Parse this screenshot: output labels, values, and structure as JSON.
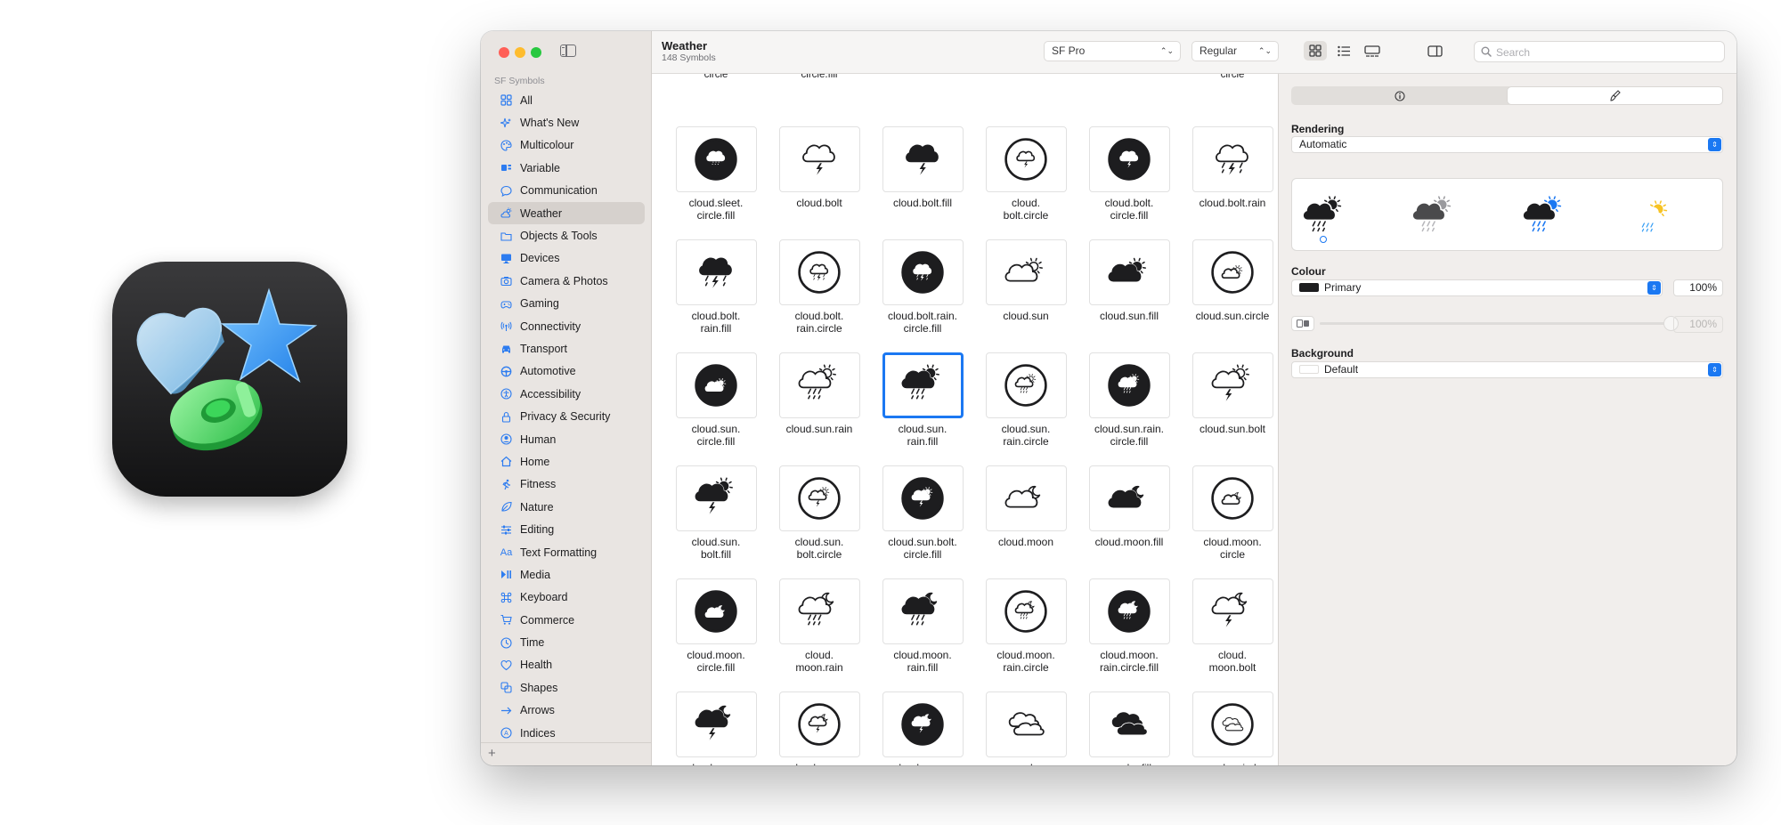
{
  "sidebar": {
    "section_label": "SF Symbols",
    "items": [
      {
        "label": "All",
        "icon": "grid-icon",
        "glyph": "grid",
        "active": false
      },
      {
        "label": "What's New",
        "icon": "sparkles-icon",
        "glyph": "sparkles",
        "active": false
      },
      {
        "label": "Multicolour",
        "icon": "paintpalette-icon",
        "glyph": "palette",
        "active": false
      },
      {
        "label": "Variable",
        "icon": "slider-icon",
        "glyph": "variable",
        "active": false
      },
      {
        "label": "Communication",
        "icon": "message-icon",
        "glyph": "bubble",
        "active": false
      },
      {
        "label": "Weather",
        "icon": "cloud-sun-icon",
        "glyph": "cloudsun",
        "active": true
      },
      {
        "label": "Objects & Tools",
        "icon": "folder-icon",
        "glyph": "folder",
        "active": false
      },
      {
        "label": "Devices",
        "icon": "desktop-icon",
        "glyph": "desktop",
        "active": false
      },
      {
        "label": "Camera & Photos",
        "icon": "camera-icon",
        "glyph": "camera",
        "active": false
      },
      {
        "label": "Gaming",
        "icon": "gamecontroller-icon",
        "glyph": "gamepad",
        "active": false
      },
      {
        "label": "Connectivity",
        "icon": "antenna-icon",
        "glyph": "antenna",
        "active": false
      },
      {
        "label": "Transport",
        "icon": "car-icon",
        "glyph": "car",
        "active": false
      },
      {
        "label": "Automotive",
        "icon": "steering-wheel-icon",
        "glyph": "wheel",
        "active": false
      },
      {
        "label": "Accessibility",
        "icon": "accessibility-icon",
        "glyph": "access",
        "active": false
      },
      {
        "label": "Privacy & Security",
        "icon": "lock-icon",
        "glyph": "lock",
        "active": false
      },
      {
        "label": "Human",
        "icon": "person-icon",
        "glyph": "person",
        "active": false
      },
      {
        "label": "Home",
        "icon": "house-icon",
        "glyph": "house",
        "active": false
      },
      {
        "label": "Fitness",
        "icon": "figure-run-icon",
        "glyph": "run",
        "active": false
      },
      {
        "label": "Nature",
        "icon": "leaf-icon",
        "glyph": "leaf",
        "active": false
      },
      {
        "label": "Editing",
        "icon": "sliders-icon",
        "glyph": "sliders",
        "active": false
      },
      {
        "label": "Text Formatting",
        "icon": "textformat-icon",
        "glyph": "Aa",
        "active": false
      },
      {
        "label": "Media",
        "icon": "playpause-icon",
        "glyph": "media",
        "active": false
      },
      {
        "label": "Keyboard",
        "icon": "command-icon",
        "glyph": "command",
        "active": false
      },
      {
        "label": "Commerce",
        "icon": "cart-icon",
        "glyph": "cart",
        "active": false
      },
      {
        "label": "Time",
        "icon": "clock-icon",
        "glyph": "clock",
        "active": false
      },
      {
        "label": "Health",
        "icon": "heart-icon",
        "glyph": "heart",
        "active": false
      },
      {
        "label": "Shapes",
        "icon": "shapes-icon",
        "glyph": "shapes",
        "active": false
      },
      {
        "label": "Arrows",
        "icon": "arrow-right-icon",
        "glyph": "arrow",
        "active": false
      },
      {
        "label": "Indices",
        "icon": "indices-icon",
        "glyph": "indices",
        "active": false
      }
    ]
  },
  "toolbar": {
    "title": "Weather",
    "subtitle": "148 Symbols",
    "font_popup": "SF Pro",
    "weight_popup": "Regular",
    "search_placeholder": "Search"
  },
  "grid": {
    "partial_labels": [
      "circle",
      "circle.fill",
      "",
      "",
      "",
      "circle"
    ],
    "symbols": [
      {
        "label": "cloud.sleet.\ncircle.fill",
        "icon": "cloud-sleet-circle-fill-icon",
        "shape": "cloud",
        "style": "circle-fill",
        "precip": "sleet",
        "extra": "none",
        "selected": false
      },
      {
        "label": "cloud.bolt",
        "icon": "cloud-bolt-icon",
        "shape": "cloud",
        "style": "outline",
        "precip": "bolt",
        "extra": "none",
        "selected": false
      },
      {
        "label": "cloud.bolt.fill",
        "icon": "cloud-bolt-fill-icon",
        "shape": "cloud",
        "style": "fill",
        "precip": "bolt",
        "extra": "none",
        "selected": false
      },
      {
        "label": "cloud.\nbolt.circle",
        "icon": "cloud-bolt-circle-icon",
        "shape": "cloud",
        "style": "circle",
        "precip": "bolt",
        "extra": "none",
        "selected": false
      },
      {
        "label": "cloud.bolt.\ncircle.fill",
        "icon": "cloud-bolt-circle-fill-icon",
        "shape": "cloud",
        "style": "circle-fill",
        "precip": "bolt",
        "extra": "none",
        "selected": false
      },
      {
        "label": "cloud.bolt.rain",
        "icon": "cloud-bolt-rain-icon",
        "shape": "cloud",
        "style": "outline",
        "precip": "boltrain",
        "extra": "none",
        "selected": false
      },
      {
        "label": "cloud.bolt.\nrain.fill",
        "icon": "cloud-bolt-rain-fill-icon",
        "shape": "cloud",
        "style": "fill",
        "precip": "boltrain",
        "extra": "none",
        "selected": false
      },
      {
        "label": "cloud.bolt.\nrain.circle",
        "icon": "cloud-bolt-rain-circle-icon",
        "shape": "cloud",
        "style": "circle",
        "precip": "boltrain",
        "extra": "none",
        "selected": false
      },
      {
        "label": "cloud.bolt.rain.\ncircle.fill",
        "icon": "cloud-bolt-rain-circle-fill-icon",
        "shape": "cloud",
        "style": "circle-fill",
        "precip": "boltrain",
        "extra": "none",
        "selected": false
      },
      {
        "label": "cloud.sun",
        "icon": "cloud-sun-icon",
        "shape": "cloud",
        "style": "outline",
        "precip": "none",
        "extra": "sun",
        "selected": false
      },
      {
        "label": "cloud.sun.fill",
        "icon": "cloud-sun-fill-icon",
        "shape": "cloud",
        "style": "fill",
        "precip": "none",
        "extra": "sun",
        "selected": false
      },
      {
        "label": "cloud.sun.circle",
        "icon": "cloud-sun-circle-icon",
        "shape": "cloud",
        "style": "circle",
        "precip": "none",
        "extra": "sun",
        "selected": false
      },
      {
        "label": "cloud.sun.\ncircle.fill",
        "icon": "cloud-sun-circle-fill-icon",
        "shape": "cloud",
        "style": "circle-fill",
        "precip": "none",
        "extra": "sun",
        "selected": false
      },
      {
        "label": "cloud.sun.rain",
        "icon": "cloud-sun-rain-icon",
        "shape": "cloud",
        "style": "outline",
        "precip": "rain",
        "extra": "sun",
        "selected": false
      },
      {
        "label": "cloud.sun.\nrain.fill",
        "icon": "cloud-sun-rain-fill-icon",
        "shape": "cloud",
        "style": "fill",
        "precip": "rain",
        "extra": "sun",
        "selected": true
      },
      {
        "label": "cloud.sun.\nrain.circle",
        "icon": "cloud-sun-rain-circle-icon",
        "shape": "cloud",
        "style": "circle",
        "precip": "rain",
        "extra": "sun",
        "selected": false
      },
      {
        "label": "cloud.sun.rain.\ncircle.fill",
        "icon": "cloud-sun-rain-circle-fill-icon",
        "shape": "cloud",
        "style": "circle-fill",
        "precip": "rain",
        "extra": "sun",
        "selected": false
      },
      {
        "label": "cloud.sun.bolt",
        "icon": "cloud-sun-bolt-icon",
        "shape": "cloud",
        "style": "outline",
        "precip": "bolt",
        "extra": "sun",
        "selected": false
      },
      {
        "label": "cloud.sun.\nbolt.fill",
        "icon": "cloud-sun-bolt-fill-icon",
        "shape": "cloud",
        "style": "fill",
        "precip": "bolt",
        "extra": "sun",
        "selected": false
      },
      {
        "label": "cloud.sun.\nbolt.circle",
        "icon": "cloud-sun-bolt-circle-icon",
        "shape": "cloud",
        "style": "circle",
        "precip": "bolt",
        "extra": "sun",
        "selected": false
      },
      {
        "label": "cloud.sun.bolt.\ncircle.fill",
        "icon": "cloud-sun-bolt-circle-fill-icon",
        "shape": "cloud",
        "style": "circle-fill",
        "precip": "bolt",
        "extra": "sun",
        "selected": false
      },
      {
        "label": "cloud.moon",
        "icon": "cloud-moon-icon",
        "shape": "cloud",
        "style": "outline",
        "precip": "none",
        "extra": "moon",
        "selected": false
      },
      {
        "label": "cloud.moon.fill",
        "icon": "cloud-moon-fill-icon",
        "shape": "cloud",
        "style": "fill",
        "precip": "none",
        "extra": "moon",
        "selected": false
      },
      {
        "label": "cloud.moon.\ncircle",
        "icon": "cloud-moon-circle-icon",
        "shape": "cloud",
        "style": "circle",
        "precip": "none",
        "extra": "moon",
        "selected": false
      },
      {
        "label": "cloud.moon.\ncircle.fill",
        "icon": "cloud-moon-circle-fill-icon",
        "shape": "cloud",
        "style": "circle-fill",
        "precip": "none",
        "extra": "moon",
        "selected": false
      },
      {
        "label": "cloud.\nmoon.rain",
        "icon": "cloud-moon-rain-icon",
        "shape": "cloud",
        "style": "outline",
        "precip": "rain",
        "extra": "moon",
        "selected": false
      },
      {
        "label": "cloud.moon.\nrain.fill",
        "icon": "cloud-moon-rain-fill-icon",
        "shape": "cloud",
        "style": "fill",
        "precip": "rain",
        "extra": "moon",
        "selected": false
      },
      {
        "label": "cloud.moon.\nrain.circle",
        "icon": "cloud-moon-rain-circle-icon",
        "shape": "cloud",
        "style": "circle",
        "precip": "rain",
        "extra": "moon",
        "selected": false
      },
      {
        "label": "cloud.moon.\nrain.circle.fill",
        "icon": "cloud-moon-rain-circle-fill-icon",
        "shape": "cloud",
        "style": "circle-fill",
        "precip": "rain",
        "extra": "moon",
        "selected": false
      },
      {
        "label": "cloud.\nmoon.bolt",
        "icon": "cloud-moon-bolt-icon",
        "shape": "cloud",
        "style": "outline",
        "precip": "bolt",
        "extra": "moon",
        "selected": false
      },
      {
        "label": "cloud.moon.\nbolt.fill",
        "icon": "cloud-moon-bolt-fill-icon",
        "shape": "cloud",
        "style": "fill",
        "precip": "bolt",
        "extra": "moon",
        "selected": false
      },
      {
        "label": "cloud.moon.\nbolt.circle",
        "icon": "cloud-moon-bolt-circle-icon",
        "shape": "cloud",
        "style": "circle",
        "precip": "bolt",
        "extra": "moon",
        "selected": false
      },
      {
        "label": "cloud.moon.\nbolt.circle.fill",
        "icon": "cloud-moon-bolt-circle-fill-icon",
        "shape": "cloud",
        "style": "circle-fill",
        "precip": "bolt",
        "extra": "moon",
        "selected": false
      },
      {
        "label": "smoke",
        "icon": "smoke-icon",
        "shape": "smoke",
        "style": "outline",
        "precip": "none",
        "extra": "none",
        "selected": false
      },
      {
        "label": "smoke.fill",
        "icon": "smoke-fill-icon",
        "shape": "smoke",
        "style": "fill",
        "precip": "none",
        "extra": "none",
        "selected": false
      },
      {
        "label": "smoke.circle",
        "icon": "smoke-circle-icon",
        "shape": "smoke",
        "style": "circle",
        "precip": "none",
        "extra": "none",
        "selected": false
      }
    ]
  },
  "inspector": {
    "tabs": [
      {
        "icon": "info-icon",
        "active": false
      },
      {
        "icon": "paintbrush-icon",
        "active": true
      }
    ],
    "rendering_heading": "Rendering",
    "rendering_value": "Automatic",
    "rendering_modes": [
      {
        "name": "monochrome",
        "icon": "mode-monochrome-icon",
        "colors": [
          "#1d1d1f",
          "#1d1d1f",
          "#1d1d1f"
        ],
        "selected": true
      },
      {
        "name": "hierarchical",
        "icon": "mode-hierarchical-icon",
        "colors": [
          "#4a4a4c",
          "#9a9a9e",
          "#b8b8bc"
        ],
        "selected": false
      },
      {
        "name": "palette",
        "icon": "mode-palette-icon",
        "colors": [
          "#1d1d1f",
          "#1b78f2",
          "#1b78f2"
        ],
        "selected": false
      },
      {
        "name": "multicolour",
        "icon": "mode-multicolour-icon",
        "colors": [
          "#ffffff",
          "#f7c325",
          "#3aa0f5"
        ],
        "selected": false
      }
    ],
    "colour_heading": "Colour",
    "colour_value": "Primary",
    "colour_swatch": "#1d1d1f",
    "colour_pct": "100%",
    "secondary_pct": "100%",
    "background_heading": "Background",
    "background_value": "Default",
    "background_swatch": "#ffffff"
  },
  "colors": {
    "accent": "#1b78f2",
    "sidebar_bg": "#e9e5e2",
    "icon_dark": "#1d1d1f"
  }
}
